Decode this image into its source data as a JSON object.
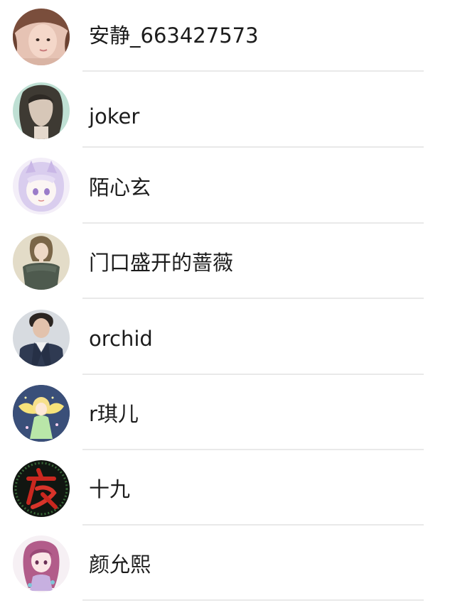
{
  "contacts": [
    {
      "name": "安静_663427573",
      "avatar_icon": "girl-portrait-avatar"
    },
    {
      "name": "joker",
      "avatar_icon": "long-hair-girl-avatar"
    },
    {
      "name": "陌心玄",
      "avatar_icon": "anime-bunny-hood-avatar"
    },
    {
      "name": "门口盛开的蔷薇",
      "avatar_icon": "girl-green-dress-avatar"
    },
    {
      "name": "orchid",
      "avatar_icon": "man-suit-avatar"
    },
    {
      "name": "r琪儿",
      "avatar_icon": "anime-fairy-avatar"
    },
    {
      "name": "十九",
      "avatar_icon": "night-calligraphy-avatar"
    },
    {
      "name": "颜允熙",
      "avatar_icon": "anime-pink-hair-avatar"
    }
  ],
  "colors": {
    "background": "#ffffff",
    "text": "#1c1c1c",
    "divider": "#e9e9e9"
  }
}
